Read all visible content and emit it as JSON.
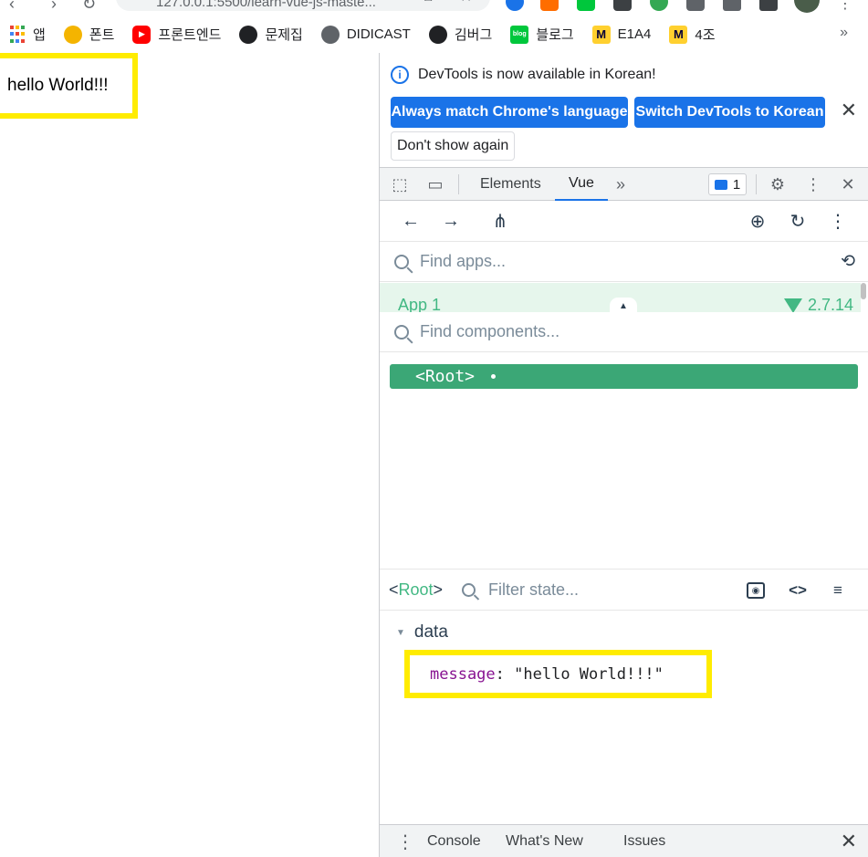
{
  "browser": {
    "url": "127.0.0.1:5500/learn-vue-js-maste...",
    "bookmarks": [
      {
        "label": "앱",
        "icon": "apps-grid-icon",
        "color": "#ea4335"
      },
      {
        "label": "폰트",
        "icon": "duck-icon",
        "color": "#f4b400"
      },
      {
        "label": "프론트엔드",
        "icon": "youtube-icon",
        "color": "#ff0000"
      },
      {
        "label": "문제집",
        "icon": "github-icon",
        "color": "#202124"
      },
      {
        "label": "DIDICAST",
        "icon": "globe-icon",
        "color": "#5f6368"
      },
      {
        "label": "김버그",
        "icon": "github-icon",
        "color": "#202124"
      },
      {
        "label": "블로그",
        "icon": "blog-icon",
        "color": "#00c73c"
      },
      {
        "label": "E1A4",
        "icon": "miro-icon",
        "color": "#ffd02f"
      },
      {
        "label": "4조",
        "icon": "miro-icon",
        "color": "#ffd02f"
      }
    ],
    "more_label": "»"
  },
  "page": {
    "hello_text": "hello World!!!"
  },
  "devtools": {
    "info_message": "DevTools is now available in Korean!",
    "btn_match": "Always match Chrome's language",
    "btn_switch": "Switch DevTools to Korean",
    "btn_dont_show": "Don't show again",
    "tabs": [
      "Elements",
      "Vue"
    ],
    "active_tab": "Vue",
    "issues_count": "1",
    "vue": {
      "find_apps_placeholder": "Find apps...",
      "app_name": "App 1",
      "vue_version": "2.7.14",
      "find_components_placeholder": "Find components...",
      "root_component": "<Root>",
      "selected_lt": "<",
      "selected_name": "Root",
      "selected_gt": ">",
      "filter_placeholder": "Filter state...",
      "data_section": "data",
      "state_key": "message",
      "state_value": "\"hello World!!!\""
    },
    "drawer_tabs": [
      "Console",
      "What's New",
      "Issues"
    ]
  },
  "colors": {
    "vue_green": "#42b883",
    "highlight_yellow": "#ffec00",
    "devtools_blue": "#1a73e8"
  }
}
